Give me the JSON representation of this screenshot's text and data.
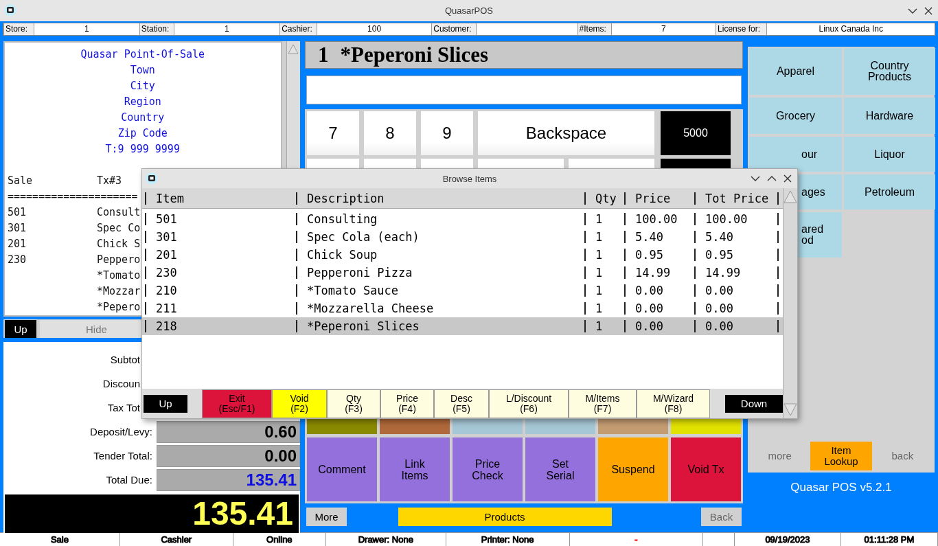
{
  "window": {
    "title": "QuasarPOS"
  },
  "info_bar": [
    {
      "label": "Store:",
      "value": "1"
    },
    {
      "label": "Station:",
      "value": "1"
    },
    {
      "label": "Cashier:",
      "value": "100"
    },
    {
      "label": "Customer:"
    },
    {
      "label": "#Items:",
      "value": "7"
    },
    {
      "label": "License for:",
      "value": "Linux Canada Inc"
    }
  ],
  "receipt": {
    "header": [
      "Quasar Point-Of-Sale",
      "Town",
      "City",
      "Region",
      "Country",
      "Zip Code",
      "T:9 999 9999"
    ],
    "sale_label": "Sale",
    "tx": "Tx#3",
    "rule": "=====================",
    "lines": [
      {
        "code": "501",
        "desc": "Consult"
      },
      {
        "code": "301",
        "desc": "Spec Co"
      },
      {
        "code": "201",
        "desc": "Chick S"
      },
      {
        "code": "230",
        "desc": "Peppero"
      },
      {
        "desc": "*Tomato"
      },
      {
        "desc": "*Mozzar"
      },
      {
        "desc": "*Pepero"
      }
    ]
  },
  "receipt_buttons": [
    {
      "label": "Up",
      "disabled": false
    },
    {
      "label": "Hide",
      "disabled": true
    }
  ],
  "totals": [
    {
      "label": "Subtot"
    },
    {
      "label": "Discoun"
    },
    {
      "label": "Tax Tot"
    },
    {
      "label": "Deposit/Levy:",
      "value": "0.60"
    },
    {
      "label": "Tender Total:",
      "value": "0.00"
    },
    {
      "label": "Total Due:",
      "value": "135.41"
    }
  ],
  "total_display": "135.41",
  "current_item": {
    "qty": "1",
    "description": "*Peperoni Slices"
  },
  "keypad": [
    "7",
    "8",
    "9",
    "Backspace",
    "5000"
  ],
  "color_keys": [
    {
      "color": "#8a8a00"
    },
    {
      "color": "#b0693a"
    },
    {
      "color": "#a6c7d6"
    },
    {
      "color": "#a6c7d6"
    },
    {
      "color": "#c49c72"
    },
    {
      "color": "#e2e200"
    }
  ],
  "functions": [
    {
      "label": "Comment",
      "color": "#9370db"
    },
    {
      "label": "Link\nItems",
      "color": "#9370db"
    },
    {
      "label": "Price\nCheck",
      "color": "#9370db"
    },
    {
      "label": "Set\nSerial",
      "color": "#9370db"
    },
    {
      "label": "Suspend",
      "color": "#ffa500"
    },
    {
      "label": "Void Tx",
      "color": "#dc143c"
    }
  ],
  "bottom_buttons": [
    {
      "label": "More",
      "kind": "nav",
      "disabled": false
    },
    {
      "label": "Products",
      "kind": "main",
      "disabled": false
    },
    {
      "label": "Back",
      "kind": "nav",
      "disabled": true
    }
  ],
  "categories": [
    {
      "label": "Apparel",
      "covered": false
    },
    {
      "label": "Country\nProducts",
      "covered": false
    },
    {
      "label": "Grocery",
      "covered": false
    },
    {
      "label": "Hardware",
      "covered": false
    },
    {
      "label": "our",
      "covered": true
    },
    {
      "label": "Liquor",
      "covered": false
    },
    {
      "label": "ages",
      "covered": true
    },
    {
      "label": "Petroleum",
      "covered": false
    },
    {
      "label": "ared\nod",
      "covered": true
    }
  ],
  "category_nav": [
    {
      "label": "more",
      "kind": "nav",
      "disabled": true
    },
    {
      "label": "Item\nLookup",
      "kind": "main",
      "disabled": false
    },
    {
      "label": "back",
      "kind": "nav",
      "disabled": true
    }
  ],
  "version": "Quasar POS v5.2.1",
  "status_bar": [
    {
      "text": "Sale",
      "color": "#000000"
    },
    {
      "text": "Cashier",
      "color": "#000000"
    },
    {
      "text": "Online",
      "color": "#000000"
    },
    {
      "text": "Drawer: None",
      "color": "#000000"
    },
    {
      "text": "Printer: None",
      "color": "#000000"
    },
    {
      "text": "-",
      "color": "#ff0000"
    },
    {
      "text": "09/19/2023",
      "color": "#000000"
    },
    {
      "text": "01:11:28 PM",
      "color": "#000000"
    }
  ],
  "dialog": {
    "title": "Browse Items",
    "columns": [
      "Item",
      "Description",
      "Qty",
      "Price",
      "Tot Price"
    ],
    "rows": [
      {
        "cells": [
          "501",
          "Consulting",
          "1",
          "100.00",
          "100.00"
        ],
        "selected": false
      },
      {
        "cells": [
          "301",
          "Spec Cola (each)",
          "1",
          "5.40",
          "5.40"
        ],
        "selected": false
      },
      {
        "cells": [
          "201",
          "Chick Soup",
          "1",
          "0.95",
          "0.95"
        ],
        "selected": false
      },
      {
        "cells": [
          "230",
          "Pepperoni Pizza",
          "1",
          "14.99",
          "14.99"
        ],
        "selected": false
      },
      {
        "cells": [
          "210",
          "*Tomato Sauce",
          "1",
          "0.00",
          "0.00"
        ],
        "selected": false
      },
      {
        "cells": [
          "211",
          "*Mozzarella Cheese",
          "1",
          "0.00",
          "0.00"
        ],
        "selected": false
      },
      {
        "cells": [
          "218",
          "*Peperoni Slices",
          "1",
          "0.00",
          "0.00"
        ],
        "selected": true
      }
    ],
    "buttons": [
      {
        "label": "Up",
        "kind": "nav"
      },
      {
        "label": "Exit\n(Esc/F1)",
        "kind": "exit"
      },
      {
        "label": "Void\n(F2)",
        "kind": "void"
      },
      {
        "label": "Qty\n(F3)",
        "kind": "fn"
      },
      {
        "label": "Price\n(F4)",
        "kind": "fn"
      },
      {
        "label": "Desc\n(F5)",
        "kind": "fn"
      },
      {
        "label": "L/Discount\n(F6)",
        "kind": "fn"
      },
      {
        "label": "M/Items\n(F7)",
        "kind": "fn"
      },
      {
        "label": "M/Wizard\n(F8)",
        "kind": "fn"
      },
      {
        "label": "Down",
        "kind": "nav"
      }
    ]
  }
}
